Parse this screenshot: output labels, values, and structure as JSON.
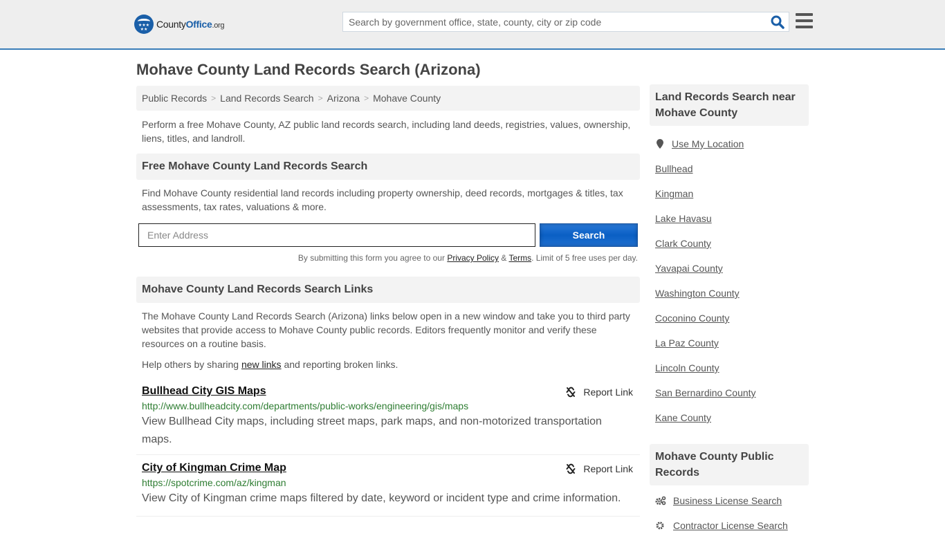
{
  "header": {
    "logo": {
      "part1": "County",
      "part2": "Office",
      "part3": ".org"
    },
    "search_placeholder": "Search by government office, state, county, city or zip code"
  },
  "page_title": "Mohave County Land Records Search (Arizona)",
  "breadcrumb": [
    "Public Records",
    "Land Records Search",
    "Arizona",
    "Mohave County"
  ],
  "intro": "Perform a free Mohave County, AZ public land records search, including land deeds, registries, values, ownership, liens, titles, and landroll.",
  "free_search": {
    "heading": "Free Mohave County Land Records Search",
    "description": "Find Mohave County residential land records including property ownership, deed records, mortgages & titles, tax assessments, tax rates, valuations & more.",
    "address_placeholder": "Enter Address",
    "button_label": "Search",
    "terms_prefix": "By submitting this form you agree to our ",
    "privacy_label": "Privacy Policy",
    "amp": " & ",
    "terms_label": "Terms",
    "terms_suffix": ". Limit of 5 free uses per day."
  },
  "links_section": {
    "heading": "Mohave County Land Records Search Links",
    "description": "The Mohave County Land Records Search (Arizona) links below open in a new window and take you to third party websites that provide access to Mohave County public records. Editors frequently monitor and verify these resources on a routine basis.",
    "help_prefix": "Help others by sharing ",
    "help_link": "new links",
    "help_suffix": " and reporting broken links.",
    "report_label": "Report Link",
    "items": [
      {
        "title": "Bullhead City GIS Maps",
        "url": "http://www.bullheadcity.com/departments/public-works/engineering/gis/maps",
        "description": "View Bullhead City maps, including street maps, park maps, and non-motorized transportation maps."
      },
      {
        "title": "City of Kingman Crime Map",
        "url": "https://spotcrime.com/az/kingman",
        "description": "View City of Kingman crime maps filtered by date, keyword or incident type and crime information."
      }
    ]
  },
  "sidebar": {
    "nearby_heading": "Land Records Search near Mohave County",
    "use_location": "Use My Location",
    "nearby": [
      "Bullhead",
      "Kingman",
      "Lake Havasu",
      "Clark County",
      "Yavapai County",
      "Washington County",
      "Coconino County",
      "La Paz County",
      "Lincoln County",
      "San Bernardino County",
      "Kane County"
    ],
    "public_heading": "Mohave County Public Records",
    "public_links": [
      "Business License Search",
      "Contractor License Search"
    ]
  },
  "colors": {
    "brand_blue": "#1a5fa8",
    "header_border": "#3a7db8",
    "url_green": "#2e7d32",
    "button_blue": "#0a5fc4"
  }
}
